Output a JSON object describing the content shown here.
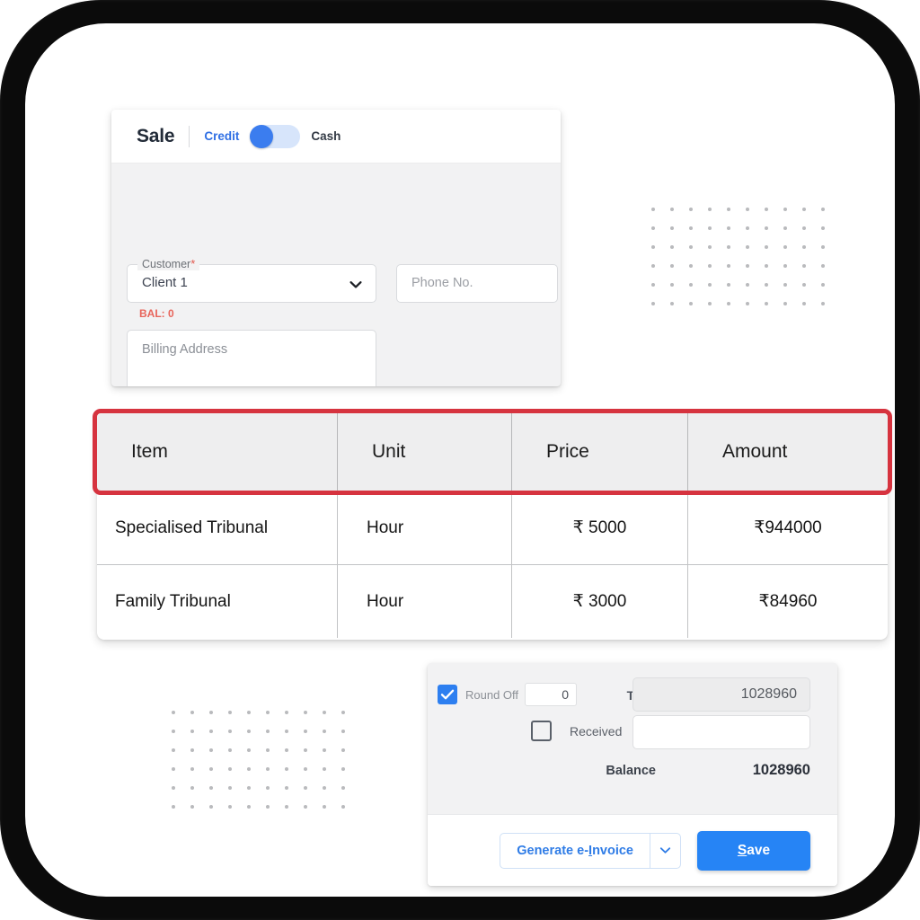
{
  "sale_card": {
    "title": "Sale",
    "payment_toggle": {
      "left_label": "Credit",
      "right_label": "Cash",
      "selected": "Credit",
      "accent_color": "#3b7def",
      "track_color": "#d7e5fb"
    },
    "customer": {
      "legend": "Customer",
      "required_mark": "*",
      "value": "Client 1",
      "caret_icon": "chevron-down-icon",
      "balance_text": "BAL: 0",
      "balance_color": "#e8655b"
    },
    "phone": {
      "placeholder": "Phone No."
    },
    "billing_address": {
      "placeholder": "Billing Address"
    }
  },
  "items_table": {
    "highlight_color": "#d6333f",
    "columns": [
      "Item",
      "Unit",
      "Price",
      "Amount"
    ],
    "rows": [
      {
        "item": "Specialised Tribunal",
        "unit": "Hour",
        "price": "₹ 5000",
        "amount": "₹944000"
      },
      {
        "item": "Family Tribunal",
        "unit": "Hour",
        "price": "₹ 3000",
        "amount": "₹84960"
      }
    ]
  },
  "totals": {
    "round_off": {
      "label": "Round Off",
      "checked": true,
      "value": "0",
      "checkbox_color": "#2d7ff0"
    },
    "total": {
      "label": "Total",
      "value": "1028960"
    },
    "received": {
      "label": "Received",
      "checked": false,
      "value": ""
    },
    "balance": {
      "label": "Balance",
      "value": "1028960"
    },
    "actions": {
      "einvoice_label_pre": "Generate e-",
      "einvoice_label_underlined": "I",
      "einvoice_label_post": "nvoice",
      "einvoice_caret_icon": "chevron-down-icon",
      "save_label_underlined": "S",
      "save_label_post": "ave",
      "save_color": "#2684f5"
    }
  },
  "decoration": {
    "dot_grid_columns": 10,
    "dot_grid_rows": 6,
    "dot_color": "#b9babd"
  }
}
